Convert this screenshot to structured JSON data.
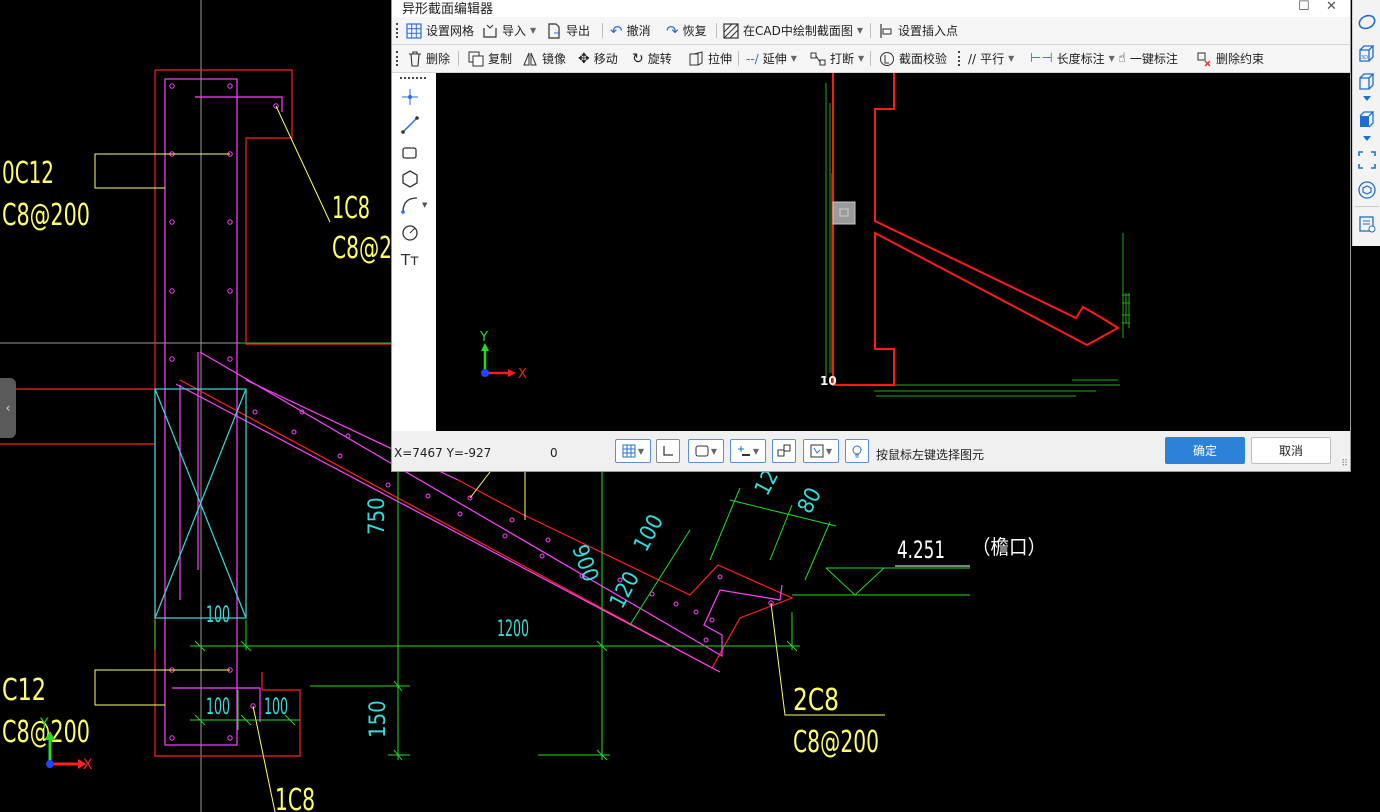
{
  "editor": {
    "title": "异形截面编辑器",
    "toolbar1": {
      "grid": "设置网格",
      "import": "导入",
      "export": "导出",
      "undo": "撤消",
      "redo": "恢复",
      "draw_in_cad": "在CAD中绘制截面图",
      "insert_point": "设置插入点"
    },
    "toolbar2": {
      "delete": "删除",
      "copy": "复制",
      "mirror": "镜像",
      "move": "移动",
      "rotate": "旋转",
      "stretch": "拉伸",
      "extend": "延伸",
      "break": "打断",
      "check": "截面校验",
      "parallel": "平行",
      "length_dim": "长度标注",
      "auto_dim": "一键标注",
      "del_constraint": "删除约束"
    },
    "canvas": {
      "axis_x": "X",
      "axis_y": "Y",
      "marker": "10"
    },
    "status": {
      "coordinates": "X=7467 Y=-927",
      "value": "0",
      "hint": "按鼠标左键选择图元",
      "ok": "确定",
      "cancel": "取消"
    }
  },
  "cad_labels": {
    "rebar_top_left": "0C12",
    "stirrup_top_left": "C8@200",
    "rebar_1c8_top": "1C8",
    "stirrup_partial": "C8@2",
    "rebar_bottom_left": "C12",
    "stirrup_bottom_left": "C8@200",
    "rebar_1c8_bottom": "1C8",
    "rebar_2c8": "2C8",
    "stirrup_right": "C8@200",
    "dim_750": "750",
    "dim_100_a": "100",
    "dim_1200": "1200",
    "dim_100_b": "100",
    "dim_100_c": "100",
    "dim_150": "150",
    "dim_900": "900",
    "dim_120_a": "120",
    "dim_100_d": "100",
    "dim_120_b": "120",
    "dim_80": "80",
    "elevation": "4.251",
    "eave_note": "（檐口）",
    "axis_x": "X",
    "axis_y": "Y"
  },
  "colors": {
    "concrete": "#ff2020",
    "rebar": "#ff40ff",
    "leader": "#ffff66",
    "dimension": "#22dd22",
    "column": "#33dddd",
    "primary_button": "#2c82d8"
  }
}
